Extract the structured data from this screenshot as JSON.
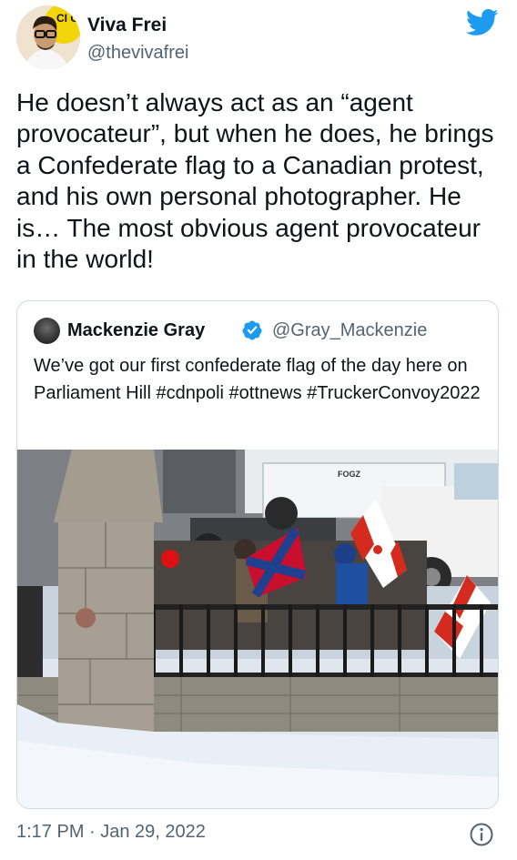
{
  "author": {
    "name": "Viva Frei",
    "handle": "@thevivafrei",
    "avatar_badge": "CI CU"
  },
  "tweet": {
    "text": "He doesn’t always act as an “agent provocateur”, but when he does, he brings a Confederate flag to a Canadian protest, and his own personal photographer. He is… The most obvious agent provocateur in the world!",
    "timestamp": "1:17 PM · Jan 29, 2022"
  },
  "quoted": {
    "name": "Mackenzie Gray",
    "handle": "@Gray_Mackenzie",
    "text": "We’ve got our first confederate flag of the day here on Parliament Hill #cdnpoli #ottnews #TruckerConvoy2022",
    "photo_truck_label": "FOGZ"
  },
  "colors": {
    "twitter_blue": "#1d9bf0",
    "handle_gray": "#536471",
    "border": "#cfd9de"
  },
  "icons": {
    "bird": "twitter-bird-icon",
    "verified": "verified-badge-icon",
    "info": "info-icon"
  }
}
